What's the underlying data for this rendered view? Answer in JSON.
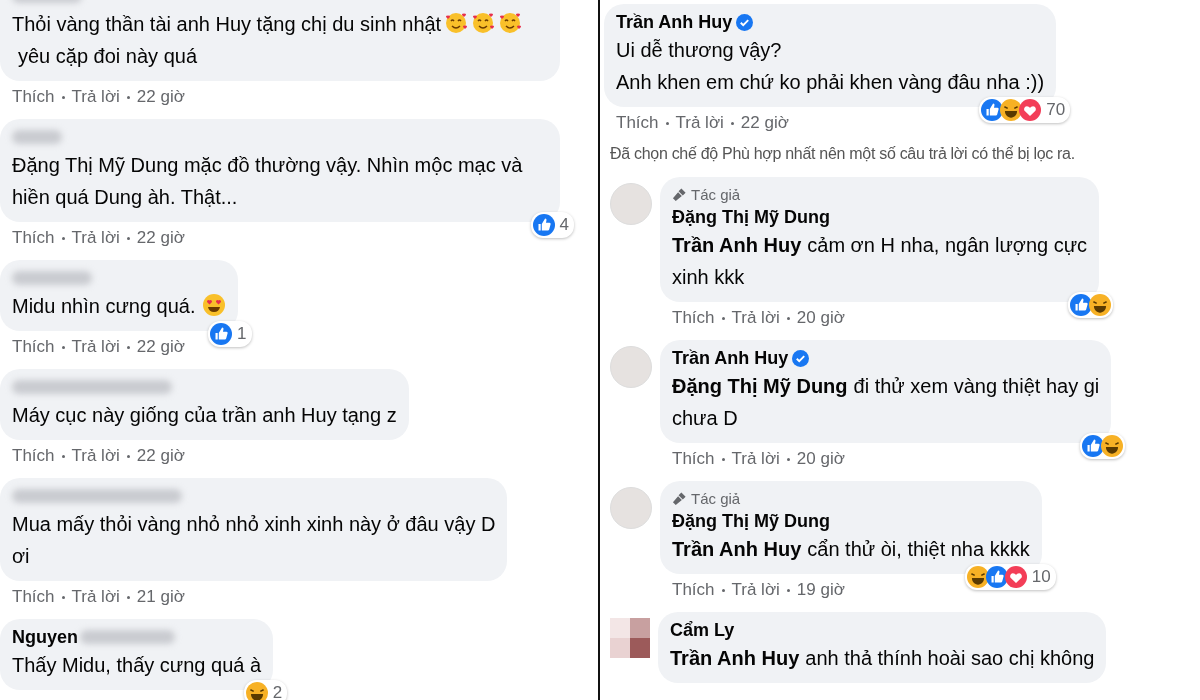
{
  "left_comments": [
    {
      "name_blurred": true,
      "body": [
        {
          "kind": "text",
          "t": "Thỏi vàng thần tài anh Huy tặng chị du sinh nhật"
        },
        {
          "kind": "hearts"
        },
        {
          "kind": "hearts"
        },
        {
          "kind": "hearts"
        },
        {
          "kind": "text",
          "t": "yêu cặp đoi này quá"
        }
      ],
      "actions": [
        "Thích",
        "Trả lời",
        "22 giờ"
      ]
    },
    {
      "name_blurred": true,
      "body": [
        {
          "kind": "text",
          "t": "Đặng Thị Mỹ Dung mặc đồ thường vậy. Nhìn mộc mạc và hiền quá Dung àh. Thật..."
        }
      ],
      "actions": [
        "Thích",
        "Trả lời",
        "22 giờ"
      ],
      "reactions": {
        "icons": [
          {
            "kind": "like"
          }
        ],
        "count": "4"
      }
    },
    {
      "name_blurred": true,
      "body": [
        {
          "kind": "text",
          "t": "Midu nhìn cưng quá."
        },
        {
          "kind": "heart-eyes"
        }
      ],
      "actions": [
        "Thích",
        "Trả lời",
        "22 giờ"
      ],
      "reactions": {
        "icons": [
          {
            "kind": "like"
          }
        ],
        "count": "1"
      }
    },
    {
      "name_blurred": true,
      "body": [
        {
          "kind": "text",
          "t": "Máy cục này giống của trần anh Huy tạng z"
        }
      ],
      "actions": [
        "Thích",
        "Trả lời",
        "22 giờ"
      ]
    },
    {
      "name_blurred": true,
      "body": [
        {
          "kind": "text",
          "t": "Mua mấy thỏi vàng nhỏ nhỏ xinh xinh này ở đâu vậy D\nơi"
        }
      ],
      "actions": [
        "Thích",
        "Trả lời",
        "21 giờ"
      ]
    },
    {
      "author": "Nguyen",
      "name_blurred": true,
      "body": [
        {
          "kind": "text",
          "t": "Thấy Midu, thấy cưng quá à"
        }
      ],
      "reactions": {
        "icons": [
          {
            "kind": "haha"
          }
        ],
        "count": "2"
      }
    }
  ],
  "right_thread": {
    "comment": {
      "author": "Trần Anh Huy",
      "verified": true,
      "text": "Ui dễ thương vậy?\nAnh khen em chứ ko phải khen vàng đâu nha :))",
      "reactions": {
        "icons": [
          {
            "kind": "like"
          },
          {
            "kind": "haha"
          },
          {
            "kind": "love"
          }
        ],
        "count": "70"
      },
      "actions": [
        "Thích",
        "Trả lời",
        "22 giờ"
      ]
    },
    "notice": "Đã chọn chế độ Phù hợp nhất nên một số câu trả lời có thể bị lọc ra.",
    "replies": [
      {
        "avatar": {
          "kind": "photo"
        },
        "badge": "Tác giả",
        "author": "Đặng Thị Mỹ Dung",
        "verified": false,
        "mention": "Trần Anh Huy",
        "text": "cảm ơn H nha, ngân lượng cực\nxinh kkk",
        "reactions": {
          "icons": [
            {
              "kind": "like"
            },
            {
              "kind": "haha"
            }
          ]
        },
        "actions": [
          "Thích",
          "Trả lời",
          "20 giờ"
        ]
      },
      {
        "avatar": {
          "kind": "photo"
        },
        "author": "Trần Anh Huy",
        "verified": true,
        "mention": "Đặng Thị Mỹ Dung",
        "text": "đi thử xem vàng thiệt hay gi\nchưa D",
        "reactions": {
          "icons": [
            {
              "kind": "like"
            },
            {
              "kind": "haha"
            }
          ]
        },
        "actions": [
          "Thích",
          "Trả lời",
          "20 giờ"
        ]
      },
      {
        "avatar": {
          "kind": "photo"
        },
        "badge": "Tác giả",
        "author": "Đặng Thị Mỹ Dung",
        "verified": false,
        "mention": "Trần Anh Huy",
        "text": "cẩn thử òi, thiệt nha kkkk",
        "reactions": {
          "icons": [
            {
              "kind": "haha"
            },
            {
              "kind": "like"
            },
            {
              "kind": "love"
            }
          ],
          "count": "10"
        },
        "actions": [
          "Thích",
          "Trả lời",
          "19 giờ"
        ]
      },
      {
        "avatar": {
          "kind": "pixelated"
        },
        "author": "Cẩm Ly",
        "verified": false,
        "mention": "Trần Anh Huy",
        "text": "anh thả thính hoài sao chị không"
      }
    ]
  }
}
